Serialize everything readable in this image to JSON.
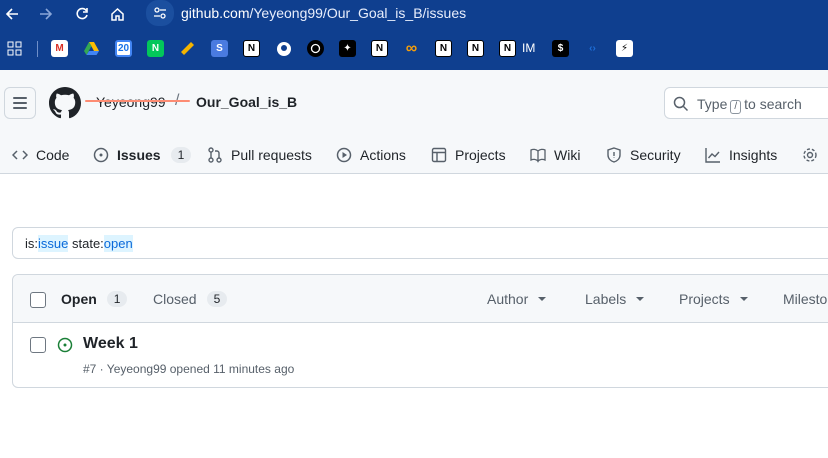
{
  "browser": {
    "url_host": "github.com",
    "url_path": "/Yeyeong99/Our_Goal_is_B/issues",
    "bookmark_text": "IM"
  },
  "header": {
    "owner": "Yeyeong99",
    "separator": "/",
    "repo": "Our_Goal_is_B",
    "search": {
      "prefix": "Type",
      "key": "/",
      "suffix": "to search"
    }
  },
  "repo_nav": {
    "tabs": [
      {
        "label": "Code",
        "icon": "code-icon"
      },
      {
        "label": "Issues",
        "icon": "issue-opened-icon",
        "count": "1",
        "selected": true
      },
      {
        "label": "Pull requests",
        "icon": "git-pull-request-icon"
      },
      {
        "label": "Actions",
        "icon": "play-icon"
      },
      {
        "label": "Projects",
        "icon": "table-icon"
      },
      {
        "label": "Wiki",
        "icon": "book-icon"
      },
      {
        "label": "Security",
        "icon": "shield-icon"
      },
      {
        "label": "Insights",
        "icon": "graph-icon"
      }
    ]
  },
  "issues": {
    "query": {
      "k1": "is:",
      "v1": "issue",
      "k2": "state:",
      "v2": "open"
    },
    "open_label": "Open",
    "open_count": "1",
    "closed_label": "Closed",
    "closed_count": "5",
    "filters": [
      "Author",
      "Labels",
      "Projects",
      "Milestones"
    ],
    "list": [
      {
        "title": "Week 1",
        "meta": "#7 · Yeyeong99 opened 11 minutes ago"
      }
    ]
  },
  "colors": {
    "browser_bar": "#0f3f8f",
    "accent_underline": "#fd8c73",
    "open_icon": "#1a7f37",
    "token_bg": "#ddf4ff"
  }
}
